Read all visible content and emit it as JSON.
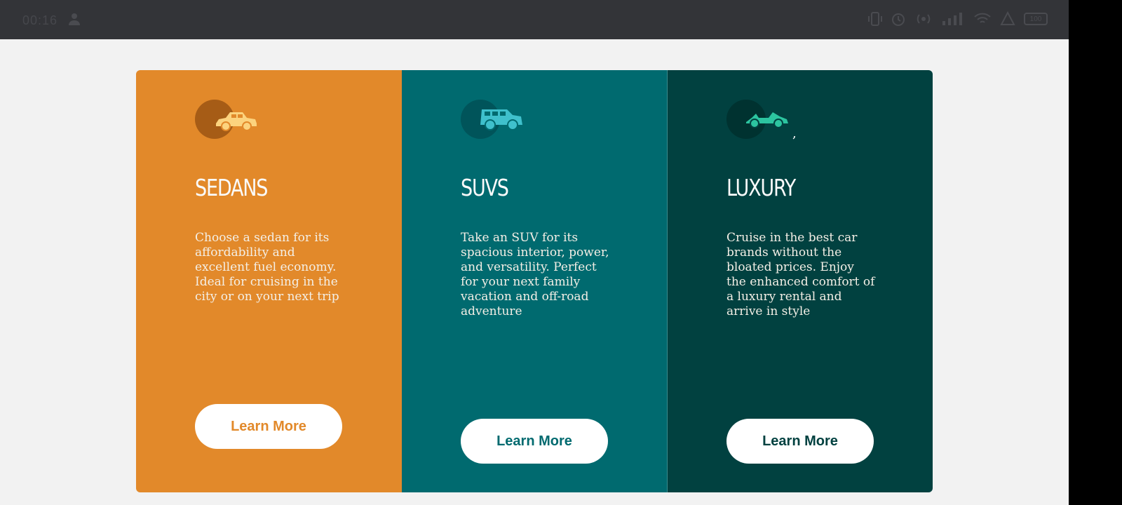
{
  "statusbar": {
    "time": "00:16",
    "battery": "100",
    "icons": [
      "person-icon",
      "vibrate-icon",
      "alarm-icon",
      "hotspot-icon",
      "signal-icon",
      "wifi-icon",
      "notification-icon",
      "battery-icon"
    ]
  },
  "cards": [
    {
      "title": "SEDANS",
      "description": "Choose a sedan for its affordability and excellent fuel economy. Ideal for cruising in the city or on your next trip",
      "button": "Learn More",
      "icon": "sedan-car-icon",
      "color": "#e2892a"
    },
    {
      "title": "SUVS",
      "description": "Take an SUV for its spacious interior, power, and versatility. Perfect for your next family vacation and off-road adventure",
      "button": "Learn More",
      "icon": "suv-car-icon",
      "color": "#006a6f"
    },
    {
      "title": "LUXURY",
      "description": "Cruise in the best car brands without the bloated prices. Enjoy the enhanced comfort of a luxury rental and arrive in style",
      "button": "Learn More",
      "icon": "luxury-car-icon",
      "color": "#014140",
      "stray_mark": ","
    }
  ]
}
